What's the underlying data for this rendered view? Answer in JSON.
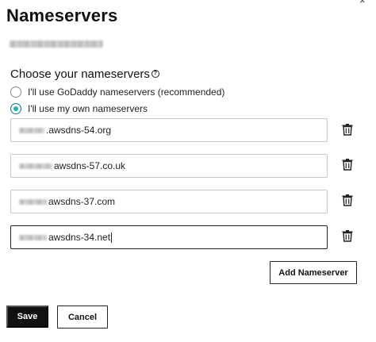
{
  "dialog": {
    "title": "Nameservers"
  },
  "choice": {
    "label": "Choose your nameservers",
    "help_icon": "question-circle-icon",
    "options": [
      {
        "label": "I'll use GoDaddy nameservers (recommended)",
        "selected": false
      },
      {
        "label": "I'll use my own nameservers",
        "selected": true
      }
    ]
  },
  "nameservers": [
    {
      "value": ".awsdns-54.org"
    },
    {
      "value": "awsdns-57.co.uk"
    },
    {
      "value": "awsdns-37.com"
    },
    {
      "value": "awsdns-34.net"
    }
  ],
  "icons": {
    "close": "close-icon",
    "delete": "trash-icon"
  },
  "colors": {
    "radio_selected": "#1bb5b5",
    "primary_button": "#111111"
  },
  "buttons": {
    "add_label": "Add Nameserver",
    "save_label": "Save",
    "cancel_label": "Cancel"
  }
}
